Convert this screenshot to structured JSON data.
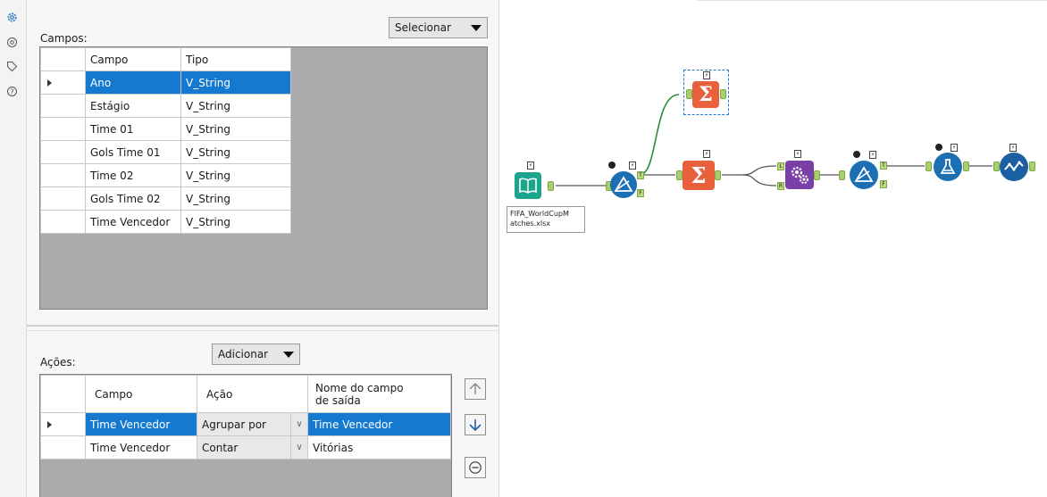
{
  "campos_section": {
    "label": "Campos:",
    "select_button": "Selecionar",
    "headers": [
      "Campo",
      "Tipo"
    ],
    "rows": [
      {
        "campo": "Ano",
        "tipo": "V_String",
        "selected": true
      },
      {
        "campo": "Estágio",
        "tipo": "V_String",
        "selected": false
      },
      {
        "campo": "Time 01",
        "tipo": "V_String",
        "selected": false
      },
      {
        "campo": "Gols Time 01",
        "tipo": "V_String",
        "selected": false
      },
      {
        "campo": "Time 02",
        "tipo": "V_String",
        "selected": false
      },
      {
        "campo": "Gols Time 02",
        "tipo": "V_String",
        "selected": false
      },
      {
        "campo": "Time Vencedor",
        "tipo": "V_String",
        "selected": false
      }
    ]
  },
  "acoes_section": {
    "label": "Ações:",
    "add_button": "Adicionar",
    "headers": {
      "campo": "Campo",
      "acao": "Ação",
      "nome_line1": "Nome do campo",
      "nome_line2": "de saída"
    },
    "rows": [
      {
        "campo": "Time Vencedor",
        "acao": "Agrupar por",
        "nome": "Time Vencedor",
        "selected": true
      },
      {
        "campo": "Time Vencedor",
        "acao": "Contar",
        "nome": "Vitórias",
        "selected": false
      }
    ]
  },
  "canvas": {
    "input_tool_label_line1": "FIFA_WorldCupM",
    "input_tool_label_line2": "atches.xlsx",
    "anchor_true": "T",
    "anchor_false": "F",
    "anchor_left": "L",
    "anchor_right": "R",
    "lightning": "⚡"
  },
  "colors": {
    "selection": "#1479cf",
    "input_tool": "#1aa58c",
    "summarize_tool": "#e8613c",
    "join_tool": "#7b3fa8",
    "filter_tool": "#1d6fb3",
    "connection": "#555555",
    "connection_green": "#2e8b3a"
  },
  "icons": [
    "gear-icon",
    "at-icon",
    "tag-icon",
    "help-icon",
    "arrow-up-icon",
    "arrow-down-icon",
    "remove-icon"
  ]
}
